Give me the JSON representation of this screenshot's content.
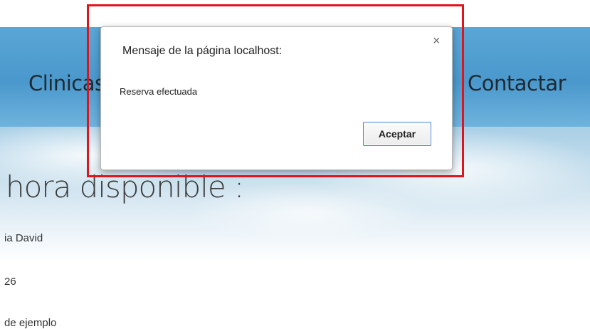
{
  "nav": {
    "clinicas_label": "Clinicas",
    "contactar_label": "Contactar"
  },
  "page": {
    "heading": "hora disponible :",
    "fields": [
      "ia David",
      "26",
      "de ejemplo"
    ]
  },
  "dialog": {
    "title": "Mensaje de la página localhost:",
    "close_icon": "close-icon",
    "close_glyph": "×",
    "message": "Reserva efectuada",
    "accept_label": "Aceptar"
  },
  "colors": {
    "highlight_border": "#e0141b",
    "nav_background": "#4a98cc",
    "button_border": "#4d7fcf"
  }
}
